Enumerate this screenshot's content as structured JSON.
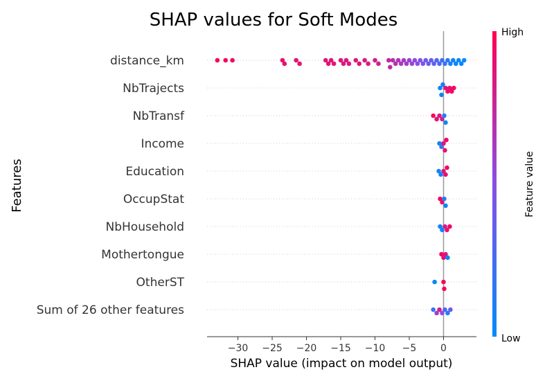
{
  "chart_data": {
    "type": "scatter",
    "subtype": "shap-beeswarm",
    "title": "SHAP values for Soft Modes",
    "xlabel": "SHAP value (impact on model output)",
    "ylabel": "Features",
    "xlim": [
      -34.5,
      4.8
    ],
    "xticks": [
      -30,
      -25,
      -20,
      -15,
      -10,
      -5,
      0
    ],
    "xtick_labels": [
      "−30",
      "−25",
      "−20",
      "−15",
      "−10",
      "−5",
      "0"
    ],
    "grid": "dotted horizontal row lines",
    "features": [
      "distance_km",
      "NbTrajects",
      "NbTransf",
      "Income",
      "Education",
      "OccupStat",
      "NbHousehold",
      "Mothertongue",
      "OtherST",
      "Sum of 26 other features"
    ],
    "colorbar": {
      "label": "Feature value",
      "high_label": "High",
      "low_label": "Low",
      "high_color": "#ff0052",
      "low_color": "#008bfb"
    },
    "series": [
      {
        "feature": "distance_km",
        "points": [
          {
            "x": -33.0,
            "v": 0.95
          },
          {
            "x": -31.8,
            "v": 0.95
          },
          {
            "x": -30.8,
            "v": 0.95
          },
          {
            "x": -23.5,
            "v": 0.9
          },
          {
            "x": -23.2,
            "v": 0.9
          },
          {
            "x": -21.5,
            "v": 0.9
          },
          {
            "x": -21.0,
            "v": 0.9
          },
          {
            "x": -17.2,
            "v": 0.88
          },
          {
            "x": -16.8,
            "v": 0.88
          },
          {
            "x": -16.4,
            "v": 0.88
          },
          {
            "x": -16.0,
            "v": 0.88
          },
          {
            "x": -15.0,
            "v": 0.85
          },
          {
            "x": -14.6,
            "v": 0.85
          },
          {
            "x": -14.2,
            "v": 0.85
          },
          {
            "x": -13.8,
            "v": 0.85
          },
          {
            "x": -12.8,
            "v": 0.85
          },
          {
            "x": -12.3,
            "v": 0.85
          },
          {
            "x": -11.5,
            "v": 0.82
          },
          {
            "x": -11.0,
            "v": 0.82
          },
          {
            "x": -10.0,
            "v": 0.8
          },
          {
            "x": -9.5,
            "v": 0.78
          },
          {
            "x": -8.0,
            "v": 0.75
          },
          {
            "x": -7.8,
            "v": 0.72
          },
          {
            "x": -7.4,
            "v": 0.7
          },
          {
            "x": -7.0,
            "v": 0.68
          },
          {
            "x": -6.6,
            "v": 0.66
          },
          {
            "x": -6.2,
            "v": 0.64
          },
          {
            "x": -5.8,
            "v": 0.62
          },
          {
            "x": -5.4,
            "v": 0.6
          },
          {
            "x": -5.0,
            "v": 0.58
          },
          {
            "x": -4.6,
            "v": 0.55
          },
          {
            "x": -4.2,
            "v": 0.52
          },
          {
            "x": -3.8,
            "v": 0.5
          },
          {
            "x": -3.4,
            "v": 0.47
          },
          {
            "x": -3.0,
            "v": 0.44
          },
          {
            "x": -2.6,
            "v": 0.42
          },
          {
            "x": -2.2,
            "v": 0.4
          },
          {
            "x": -1.8,
            "v": 0.37
          },
          {
            "x": -1.4,
            "v": 0.34
          },
          {
            "x": -1.0,
            "v": 0.3
          },
          {
            "x": -0.6,
            "v": 0.28
          },
          {
            "x": -0.2,
            "v": 0.25
          },
          {
            "x": 0.2,
            "v": 0.2
          },
          {
            "x": 0.6,
            "v": 0.15
          },
          {
            "x": 1.0,
            "v": 0.1
          },
          {
            "x": 1.4,
            "v": 0.05
          },
          {
            "x": 1.8,
            "v": 0.05
          },
          {
            "x": 2.2,
            "v": 0.03
          },
          {
            "x": 2.6,
            "v": 0.02
          },
          {
            "x": 3.0,
            "v": 0.02
          }
        ]
      },
      {
        "feature": "NbTrajects",
        "points": [
          {
            "x": -0.5,
            "v": 0.05
          },
          {
            "x": -0.3,
            "v": 0.05
          },
          {
            "x": -0.1,
            "v": 0.1
          },
          {
            "x": 0.3,
            "v": 0.85
          },
          {
            "x": 0.6,
            "v": 0.9
          },
          {
            "x": 0.9,
            "v": 0.9
          },
          {
            "x": 1.2,
            "v": 0.95
          },
          {
            "x": 1.5,
            "v": 0.95
          }
        ]
      },
      {
        "feature": "NbTransf",
        "points": [
          {
            "x": -1.5,
            "v": 0.95
          },
          {
            "x": -1.0,
            "v": 0.9
          },
          {
            "x": -0.6,
            "v": 0.85
          },
          {
            "x": -0.2,
            "v": 0.8
          },
          {
            "x": 0.1,
            "v": 0.1
          },
          {
            "x": 0.3,
            "v": 0.05
          }
        ]
      },
      {
        "feature": "Income",
        "points": [
          {
            "x": -0.6,
            "v": 0.1
          },
          {
            "x": -0.3,
            "v": 0.2
          },
          {
            "x": 0.0,
            "v": 0.85
          },
          {
            "x": 0.2,
            "v": 0.9
          },
          {
            "x": 0.4,
            "v": 0.95
          }
        ]
      },
      {
        "feature": "Education",
        "points": [
          {
            "x": -0.7,
            "v": 0.05
          },
          {
            "x": -0.4,
            "v": 0.1
          },
          {
            "x": 0.0,
            "v": 0.85
          },
          {
            "x": 0.3,
            "v": 0.9
          },
          {
            "x": 0.5,
            "v": 0.95
          }
        ]
      },
      {
        "feature": "OccupStat",
        "points": [
          {
            "x": -0.5,
            "v": 0.95
          },
          {
            "x": -0.2,
            "v": 0.9
          },
          {
            "x": 0.1,
            "v": 0.1
          },
          {
            "x": 0.3,
            "v": 0.05
          }
        ]
      },
      {
        "feature": "NbHousehold",
        "points": [
          {
            "x": -0.5,
            "v": 0.05
          },
          {
            "x": -0.2,
            "v": 0.1
          },
          {
            "x": 0.2,
            "v": 0.8
          },
          {
            "x": 0.5,
            "v": 0.9
          },
          {
            "x": 0.9,
            "v": 0.95
          }
        ]
      },
      {
        "feature": "Mothertongue",
        "points": [
          {
            "x": -0.3,
            "v": 0.95
          },
          {
            "x": 0.0,
            "v": 0.9
          },
          {
            "x": 0.3,
            "v": 0.85
          },
          {
            "x": 0.6,
            "v": 0.05
          }
        ]
      },
      {
        "feature": "OtherST",
        "points": [
          {
            "x": -1.3,
            "v": 0.05
          },
          {
            "x": 0.0,
            "v": 0.95
          },
          {
            "x": 0.1,
            "v": 0.95
          }
        ]
      },
      {
        "feature": "Sum of 26 other features",
        "points": [
          {
            "x": -1.5,
            "v": 0.2
          },
          {
            "x": -1.0,
            "v": 0.6
          },
          {
            "x": -0.6,
            "v": 0.8
          },
          {
            "x": -0.2,
            "v": 0.5
          },
          {
            "x": 0.2,
            "v": 0.3
          },
          {
            "x": 0.6,
            "v": 0.1
          },
          {
            "x": 1.0,
            "v": 0.4
          }
        ]
      }
    ]
  }
}
